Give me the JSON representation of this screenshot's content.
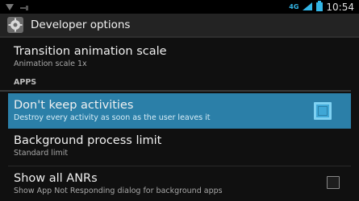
{
  "status_bar": {
    "network_label": "4G",
    "time": "10:54"
  },
  "action_bar": {
    "title": "Developer options",
    "icon": "settings-gear-icon"
  },
  "list": {
    "transition": {
      "title": "Transition animation scale",
      "summary": "Animation scale 1x"
    },
    "section_apps": "APPS",
    "dont_keep": {
      "title": "Don't keep activities",
      "summary": "Destroy every activity as soon as the user leaves it"
    },
    "bg_limit": {
      "title": "Background process limit",
      "summary": "Standard limit"
    },
    "anrs": {
      "title": "Show all ANRs",
      "summary": "Show App Not Responding dialog for background apps"
    }
  },
  "colors": {
    "accent": "#33b5e5",
    "selected_row": "#2b7fa8"
  }
}
